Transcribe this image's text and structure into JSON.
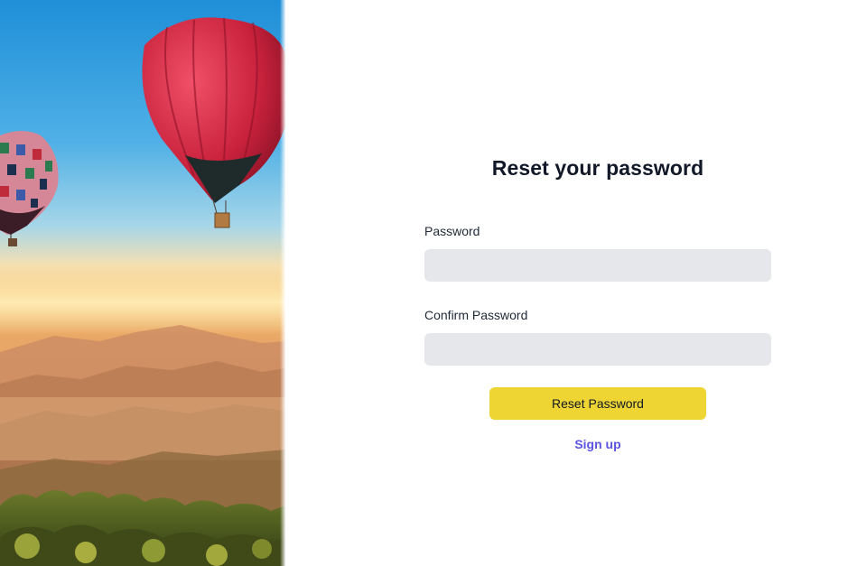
{
  "hero": {
    "image_icon": "hot-air-balloons-landscape-image"
  },
  "form": {
    "title": "Reset your password",
    "password_label": "Password",
    "password_value": "",
    "confirm_label": "Confirm Password",
    "confirm_value": "",
    "submit_label": "Reset Password",
    "signup_label": "Sign up"
  },
  "colors": {
    "button": "#eed534",
    "link": "#5b54e0",
    "input_bg": "#e5e7eb",
    "title": "#111827"
  }
}
